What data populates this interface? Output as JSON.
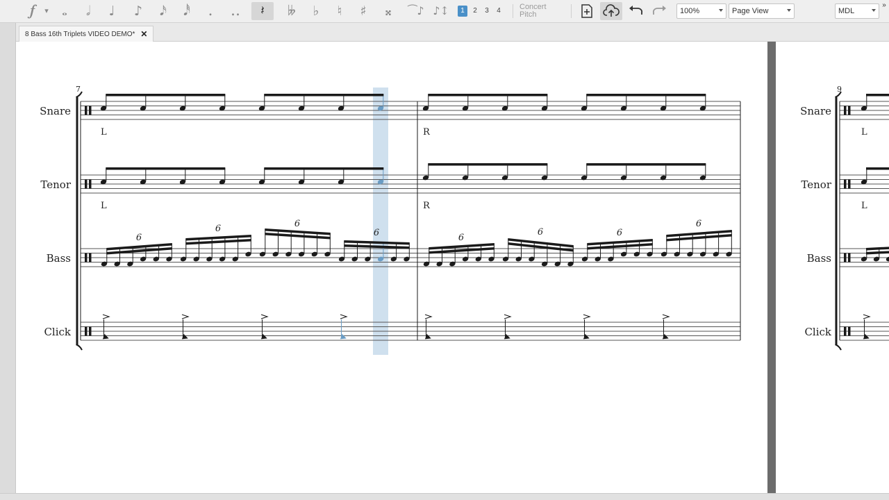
{
  "toolbar": {
    "voices": [
      "1",
      "2",
      "3",
      "4"
    ],
    "selected_voice": "1",
    "concert_pitch": "Concert Pitch",
    "zoom": "100%",
    "view_mode": "Page View",
    "workspace": "MDL"
  },
  "tab": {
    "title": "8 Bass 16th Triplets VIDEO DEMO*"
  },
  "score": {
    "staves": [
      {
        "name": "Snare"
      },
      {
        "name": "Tenor"
      },
      {
        "name": "Bass"
      },
      {
        "name": "Click"
      }
    ],
    "measure_number_left": "7",
    "measure_number_right": "9",
    "sticking": {
      "m7": "L",
      "m8": "R",
      "m9": "L"
    },
    "tuplet_number": "6"
  },
  "colors": {
    "selection": "#cfe0ee",
    "selected_note": "#6a9cc4",
    "ink": "#1a1a1a"
  }
}
